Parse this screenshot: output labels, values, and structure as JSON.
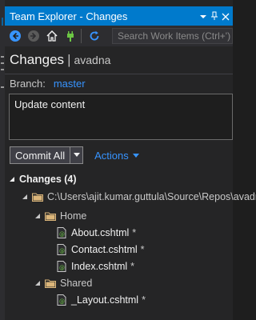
{
  "window": {
    "title": "Team Explorer - Changes"
  },
  "toolbar": {
    "search_placeholder": "Search Work Items (Ctrl+')"
  },
  "header": {
    "title": "Changes",
    "separator": "|",
    "repo": "avadna"
  },
  "branch": {
    "label": "Branch:",
    "value": "master"
  },
  "commit": {
    "message": "Update content",
    "button_label": "Commit All",
    "actions_label": "Actions"
  },
  "changes": {
    "header": "Changes (4)",
    "root_path": "C:\\Users\\ajit.kumar.guttula\\Source\\Repos\\avadna",
    "folders": [
      {
        "name": "Home",
        "files": [
          {
            "name": "About.cshtml",
            "status": "*"
          },
          {
            "name": "Contact.cshtml",
            "status": "*"
          },
          {
            "name": "Index.cshtml",
            "status": "*"
          }
        ]
      },
      {
        "name": "Shared",
        "files": [
          {
            "name": "_Layout.cshtml",
            "status": "*"
          }
        ]
      }
    ]
  },
  "colors": {
    "titlebar": "#007acc",
    "panel": "#252526",
    "link": "#3794ff",
    "folder": "#dcb67a"
  }
}
